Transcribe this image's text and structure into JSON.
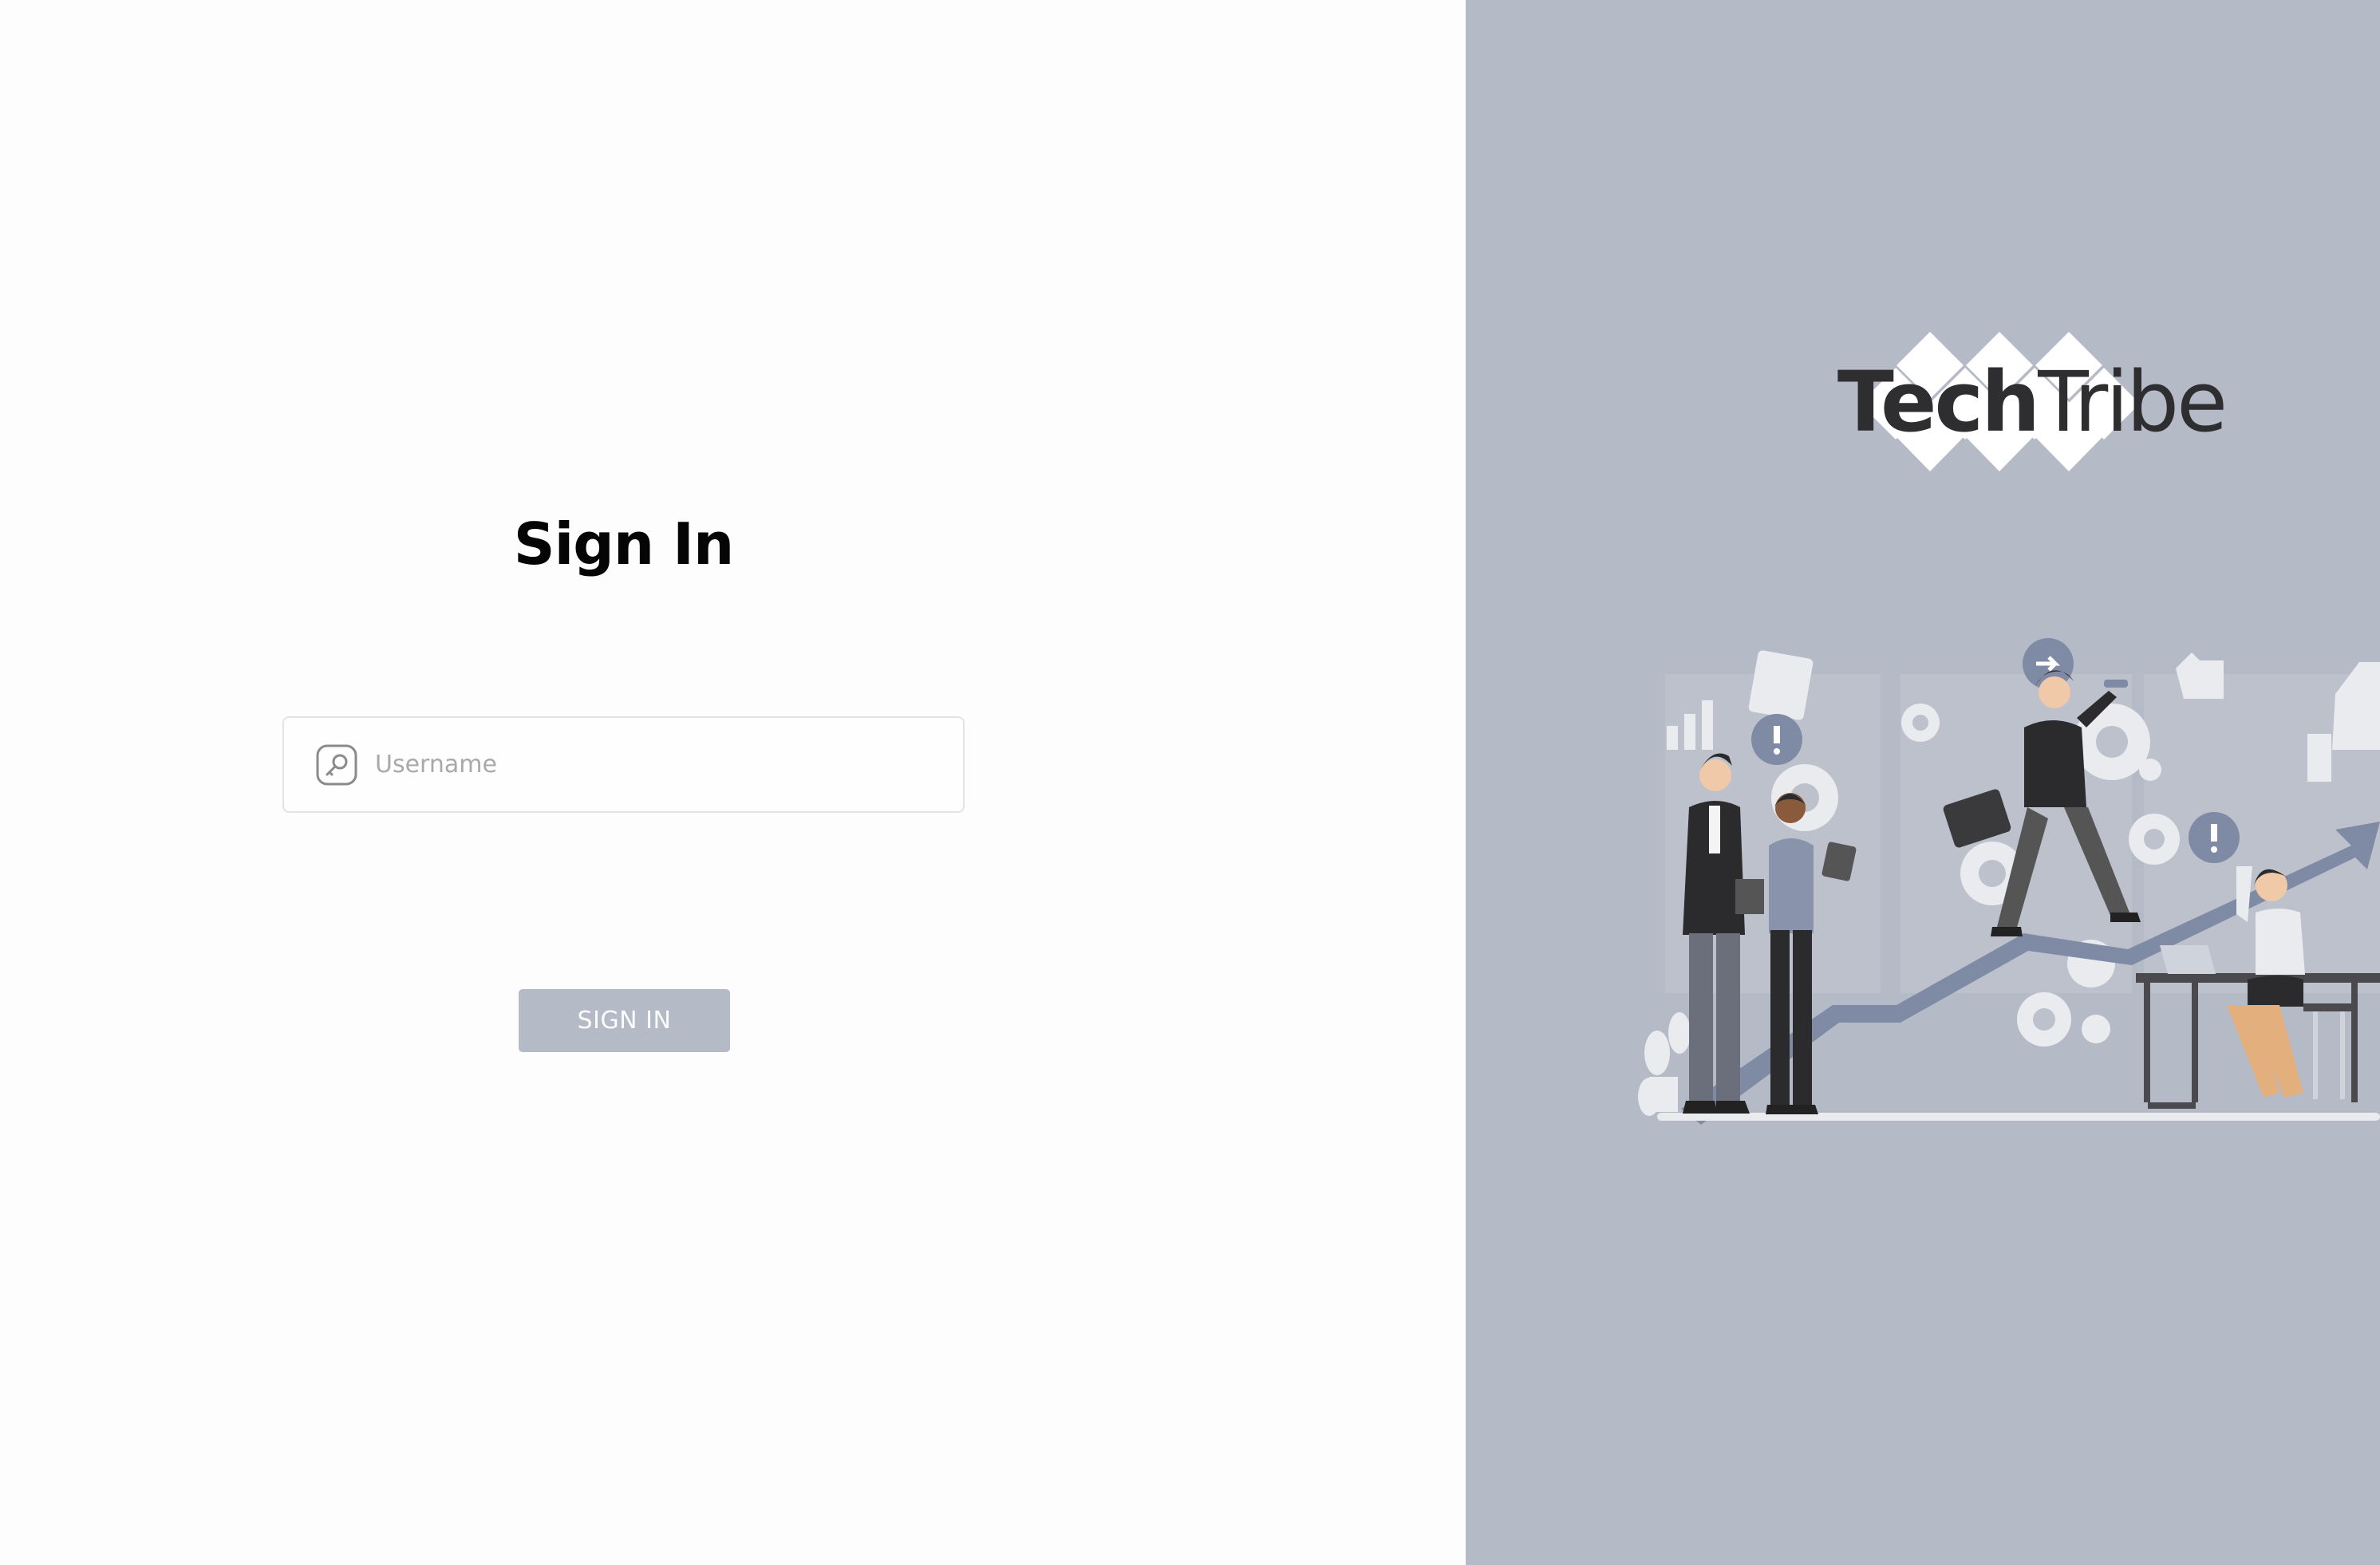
{
  "signin": {
    "title": "Sign In",
    "username_placeholder": "Username",
    "username_value": "",
    "button_label": "SIGN IN"
  },
  "brand": {
    "logo_part1": "Tech",
    "logo_part2": "Tribe"
  },
  "icons": {
    "username_field": "key-icon"
  },
  "colors": {
    "panel_background": "#b4bac6",
    "button_background": "#b4bac6",
    "title_text": "#050505",
    "logo_text": "#2e2e30"
  }
}
